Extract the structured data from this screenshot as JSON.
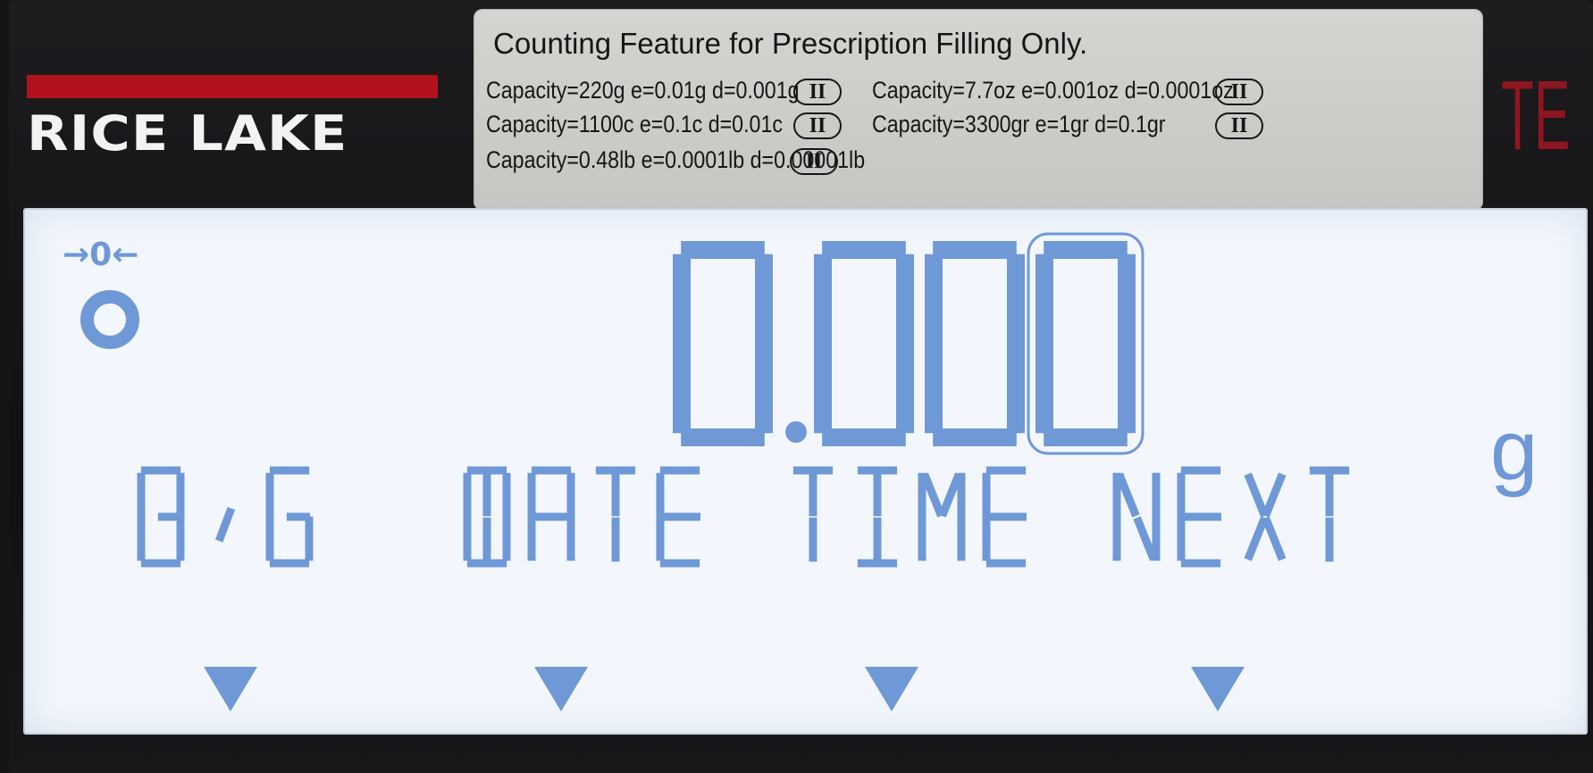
{
  "brand": {
    "name": "RICE LAKE"
  },
  "spec_label": {
    "title": "Counting Feature for Prescription Filling Only.",
    "accuracy_class": "II",
    "rows": [
      {
        "text": "Capacity=220g  e=0.01g  d=0.001g"
      },
      {
        "text": "Capacity=1100c  e=0.1c  d=0.01c"
      },
      {
        "text": "Capacity=0.48lb e=0.0001lb  d=0.00001lb"
      },
      {
        "text": "Capacity=7.7oz  e=0.001oz  d=0.0001oz"
      },
      {
        "text": "Capacity=3300gr  e=1gr  d=0.1gr"
      }
    ]
  },
  "te_logo": "TE",
  "display": {
    "zero_indicator": "→0←",
    "stable_indicator": "stable-icon",
    "weight": "0.000",
    "unit": "g",
    "softkeys": [
      {
        "label": "B/G"
      },
      {
        "label": "DATE"
      },
      {
        "label": "TIME"
      },
      {
        "label": "NEXT"
      }
    ]
  },
  "colors": {
    "lcd_background": "#f3f7fd",
    "segment": "#6f98d6",
    "brand_red": "#b1121c",
    "label_background": "#cbcbc7"
  }
}
